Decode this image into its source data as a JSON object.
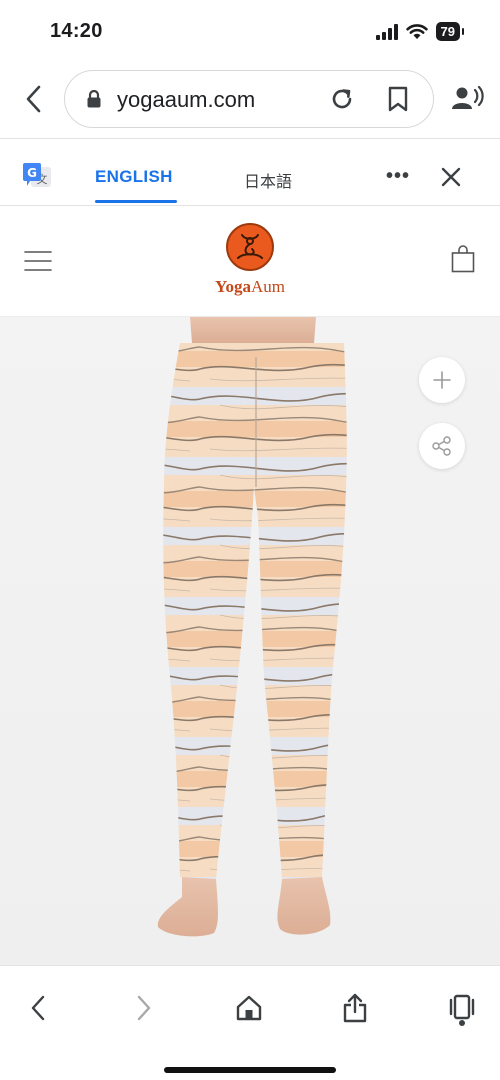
{
  "status_bar": {
    "time": "14:20",
    "battery": "79",
    "icons": [
      "cellular-signal-icon",
      "wifi-icon",
      "battery-icon"
    ]
  },
  "browser": {
    "url": "yogaaum.com",
    "icons": [
      "back-chevron-icon",
      "lock-icon",
      "reload-icon",
      "bookmark-icon",
      "profile-voice-icon"
    ]
  },
  "translate_bar": {
    "tab_english": "ENGLISH",
    "tab_japanese": "日本語",
    "more": "•••",
    "accent_color": "#1a73e8",
    "icons": [
      "google-translate-icon",
      "close-icon"
    ]
  },
  "site_header": {
    "logo_text_bold": "Yoga",
    "logo_text_regular": "Aum",
    "brand_color": "#ea5a1e",
    "icons": [
      "hamburger-menu-icon",
      "shopping-bag-icon"
    ]
  },
  "product": {
    "image_subject": "yoga-leggings-back-view",
    "icons": [
      "plus-icon",
      "share-icon"
    ]
  },
  "bottom_toolbar": {
    "icons": [
      "back-icon",
      "forward-icon",
      "home-icon",
      "share-upload-icon",
      "tabs-icon"
    ]
  }
}
